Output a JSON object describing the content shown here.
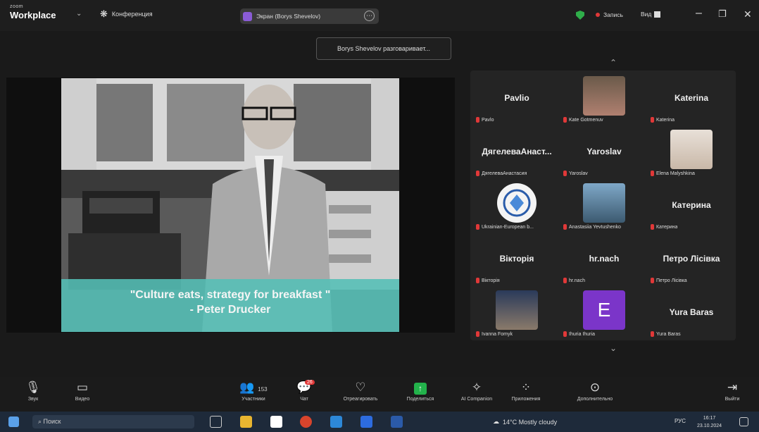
{
  "app": {
    "logo_small": "zoom",
    "logo_big": "Workplace",
    "conference_label": "Конференция"
  },
  "share_pill": {
    "label": "Экран (Borys Shevelov)"
  },
  "status": {
    "recording": "Запись",
    "view": "Вид"
  },
  "tooltip": "Borys Shevelov разговаривает...",
  "slide": {
    "quote": "\"Culture eats, strategy for breakfast \"",
    "author": "- Peter Drucker"
  },
  "participants": [
    {
      "name": "Pavlio",
      "label": "Pavlo"
    },
    {
      "name": "",
      "label": "Kate Gotmenuv"
    },
    {
      "name": "Katerina",
      "label": "Katerina"
    },
    {
      "name": "ДягелеваАнаст...",
      "label": "ДягелеваАнастасия"
    },
    {
      "name": "Yaroslav",
      "label": "Yaroslav"
    },
    {
      "name": "",
      "label": "Elena Malyshkina"
    },
    {
      "name": "",
      "label": "Ukrainian-European b..."
    },
    {
      "name": "",
      "label": "Anastasiia Yevtushenko"
    },
    {
      "name": "Катерина",
      "label": "Катерина"
    },
    {
      "name": "Вікторія",
      "label": "Вікторія"
    },
    {
      "name": "hr.nach",
      "label": "hr.nach"
    },
    {
      "name": "Петро Лісівка",
      "label": "Петро Лісівка"
    },
    {
      "name": "",
      "label": "Ivanna Fomyk"
    },
    {
      "name": "",
      "label": "Ihuria Ihuria",
      "avatar_letter": "E"
    },
    {
      "name": "Yura Baras",
      "label": "Yura Baras"
    }
  ],
  "toolbar": {
    "audio": "Звук",
    "video": "Видео",
    "participants": "Участники",
    "participants_count": "153",
    "chat": "Чат",
    "chat_badge": "26",
    "react": "Отреагировать",
    "share": "Поделиться",
    "ai": "AI Companion",
    "apps": "Приложения",
    "more": "Дополнительно",
    "leave": "Выйти"
  },
  "taskbar": {
    "search_placeholder": "Поиск",
    "weather": "14°C  Mostly cloudy",
    "lang": "РУС",
    "time": "16:17",
    "date": "23.10.2024"
  }
}
